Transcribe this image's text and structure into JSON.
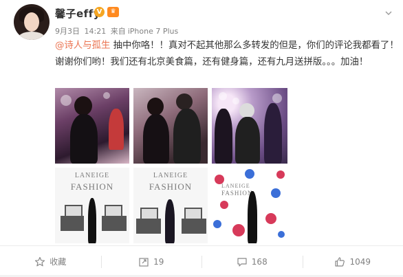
{
  "header": {
    "username": "馨子effy",
    "verified_badge": "V",
    "vip_badge": "♛",
    "date": "9月3日",
    "time": "14:21",
    "source_prefix": "来自",
    "device": "iPhone 7 Plus"
  },
  "post": {
    "mention": "@诗人与孤生",
    "text": " 抽中你咯！！真对不起其他那么多转发的但是，你们的评论我都看了！谢谢你们哟！我们还有北京美食篇，还有健身篇，还有九月送拼版。。。加油！"
  },
  "gallery": {
    "photos": [
      {
        "label": "photo-1"
      },
      {
        "label": "photo-2"
      },
      {
        "label": "photo-3"
      },
      {
        "label": "photo-4",
        "brand_top": "LANEIGE",
        "brand_bottom": "FASHION"
      },
      {
        "label": "photo-5",
        "brand_top": "LANEIGE",
        "brand_bottom": "FASHION"
      },
      {
        "label": "photo-6",
        "brand_top": "LANEIGE",
        "brand_bottom": "FASHION"
      }
    ]
  },
  "actions": {
    "favorite_label": "收藏",
    "repost_count": "19",
    "comment_count": "168",
    "like_count": "1049"
  },
  "colors": {
    "mention": "#eb7350",
    "meta": "#808080",
    "verified": "#f5a623",
    "vip": "#ff8a1f"
  },
  "icons": [
    "chevron-down-icon",
    "star-icon",
    "repost-icon",
    "comment-icon",
    "like-icon"
  ]
}
